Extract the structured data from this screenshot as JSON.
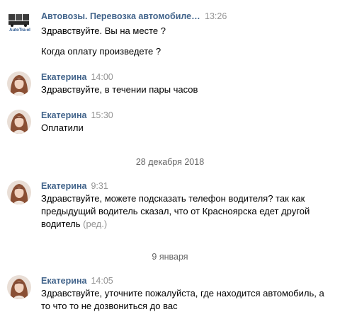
{
  "messages": [
    {
      "author": "Автовозы. Перевозка автомобилей по...",
      "time": "13:26",
      "avatar": "company-logo-avatar",
      "lines": [
        "Здравствуйте. Вы на месте ?",
        "Когда оплату произведете ?"
      ]
    },
    {
      "author": "Екатерина",
      "time": "14:00",
      "avatar": "user-photo-avatar",
      "text": "Здравствуйте, в течении пары часов"
    },
    {
      "author": "Екатерина",
      "time": "15:30",
      "avatar": "user-photo-avatar",
      "text": "Оплатили"
    },
    {
      "author": "Екатерина",
      "time": "9:31",
      "avatar": "user-photo-avatar",
      "text": "Здравствуйте, можете подсказать телефон водителя? так как предыдущий водитель сказал, что от Красноярска едет другой водитель",
      "edited_label": "(ред.)"
    },
    {
      "author": "Екатерина",
      "time": "14:05",
      "avatar": "user-photo-avatar",
      "text": "Здравствуйте, уточните пожалуйста, где находится автомобиль, а то что то не дозвониться до вас"
    }
  ],
  "date_separators": [
    "28 декабря 2018",
    "9 января"
  ],
  "logo_text": "AutoTra-el",
  "colors": {
    "author": "#42648b",
    "time": "#939393",
    "text": "#000000",
    "separator": "#656565"
  }
}
